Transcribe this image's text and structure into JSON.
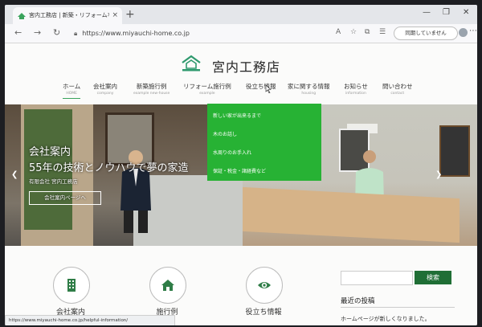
{
  "browser": {
    "tab_title": "宮内工務店 | 新築・リフォームなど宮",
    "tab_close": "×",
    "new_tab": "+",
    "url": "https://www.miyauchi-home.co.jp",
    "sync_label": "同期していません",
    "controls": {
      "minimize": "—",
      "maximize": "❐",
      "close": "✕"
    },
    "status_url": "https://www.miyauchi-home.co.jp/helpful-information/"
  },
  "site": {
    "name": "宮内工務店",
    "nav": [
      {
        "jp": "ホーム",
        "en": "HOME"
      },
      {
        "jp": "会社案内",
        "en": "company"
      },
      {
        "jp": "新築施行例",
        "en": "example new-house"
      },
      {
        "jp": "リフォーム施行例",
        "en": "example"
      },
      {
        "jp": "役立ち情報",
        "en": ""
      },
      {
        "jp": "家に関する情報",
        "en": "housing"
      },
      {
        "jp": "お知らせ",
        "en": "information"
      },
      {
        "jp": "問い合わせ",
        "en": "contact"
      }
    ],
    "dropdown": [
      "新しい家が出来るまで",
      "木のお話し",
      "水周りのお手入れ",
      "保証・税金・諸経費など"
    ]
  },
  "hero": {
    "line1": "会社案内",
    "line2": "55年の技術とノウハウで夢の家造",
    "line3": "有限会社 宮内工務店",
    "button": "会社案内ページへ",
    "prev": "❮",
    "next": "❯",
    "slides_total": 3,
    "slide_active": 1
  },
  "features": [
    {
      "label": "会社案内",
      "icon": "building-icon"
    },
    {
      "label": "施行例",
      "icon": "house-icon"
    },
    {
      "label": "役立ち情報",
      "icon": "eye-icon"
    }
  ],
  "sidebar": {
    "search_button": "検索",
    "recent_title": "最近の投稿",
    "recent_items": [
      "ホームページが新しくなりました。"
    ]
  },
  "colors": {
    "accent": "#27b234",
    "dark_green": "#1f6e35",
    "icon_green": "#2f7d47"
  }
}
